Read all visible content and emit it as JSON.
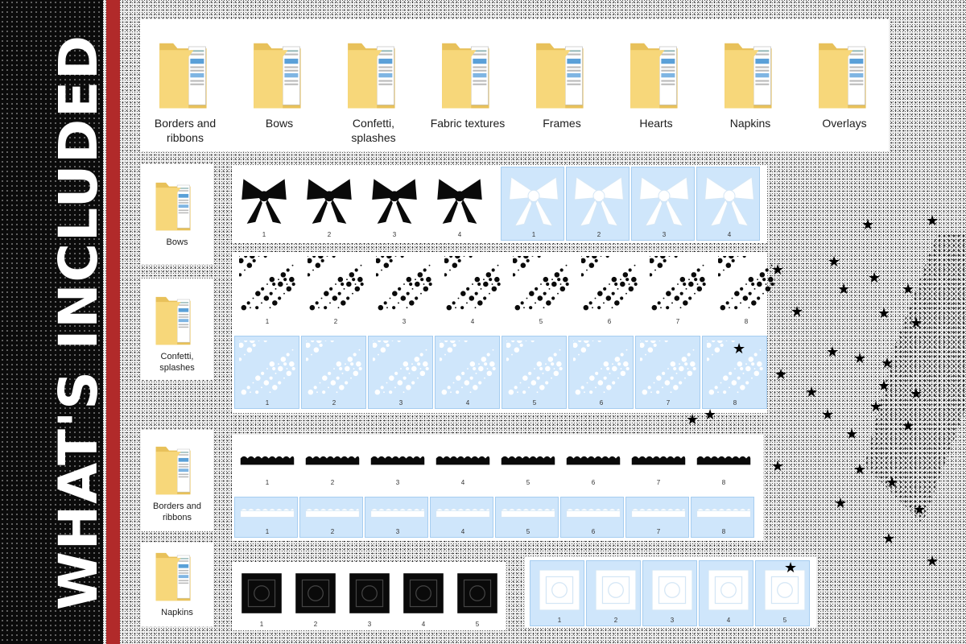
{
  "title": "WHAT'S INCLUDED",
  "top_folders": [
    "Borders and ribbons",
    "Bows",
    "Confetti, splashes",
    "Fabric textures",
    "Frames",
    "Hearts",
    "Napkins",
    "Overlays"
  ],
  "side_folders": [
    "Bows",
    "Confetti, splashes",
    "Borders and ribbons",
    "Napkins"
  ],
  "bows": {
    "black": [
      "1",
      "2",
      "3",
      "4"
    ],
    "white": [
      "1",
      "2",
      "3",
      "4"
    ]
  },
  "confetti": {
    "black": [
      "1",
      "2",
      "3",
      "4",
      "5",
      "6",
      "7",
      "8"
    ],
    "white": [
      "1",
      "2",
      "3",
      "4",
      "5",
      "6",
      "7",
      "8"
    ]
  },
  "borders": {
    "black": [
      "1",
      "2",
      "3",
      "4",
      "5",
      "6",
      "7",
      "8"
    ],
    "white": [
      "1",
      "2",
      "3",
      "4",
      "5",
      "6",
      "7",
      "8"
    ]
  },
  "napkins": {
    "black": [
      "1",
      "2",
      "3",
      "4",
      "5"
    ],
    "white": [
      "1",
      "2",
      "3",
      "4",
      "5"
    ]
  },
  "colors": {
    "red_stripe": "#b12a2a",
    "selection_blue": "#cfe6fb",
    "folder_yellow": "#f7d77a"
  },
  "icons": [
    "folder-icon",
    "bow-icon",
    "confetti-icon",
    "border-icon",
    "napkin-icon",
    "star-icon"
  ]
}
